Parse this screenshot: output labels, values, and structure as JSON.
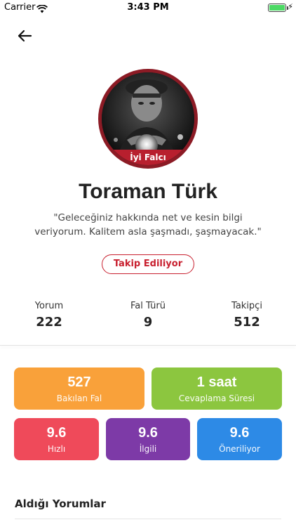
{
  "status_bar": {
    "carrier": "Carrier",
    "time": "3:43 PM",
    "battery_level": 1.0,
    "battery_color": "#4cd964"
  },
  "header": {
    "back_icon": "arrow-left-icon"
  },
  "profile": {
    "badge": "İyi Falcı",
    "name": "Toraman Türk",
    "bio": "\"Geleceğiniz hakkında net ve kesin bilgi veriyorum. Kalitem asla şaşmadı, şaşmayacak.\"",
    "follow_label": "Takip Ediliyor",
    "accent_color": "#c8202f"
  },
  "stats": [
    {
      "label": "Yorum",
      "value": "222"
    },
    {
      "label": "Fal Türü",
      "value": "9"
    },
    {
      "label": "Takipçi",
      "value": "512"
    }
  ],
  "tiles": [
    {
      "value": "527",
      "caption": "Bakılan Fal",
      "color": "#f9a13a"
    },
    {
      "value": "1 saat",
      "caption": "Cevaplama Süresi",
      "color": "#8cc63f"
    },
    {
      "value": "9.6",
      "caption": "Hızlı",
      "color": "#ef4a5a"
    },
    {
      "value": "9.6",
      "caption": "İlgili",
      "color": "#7d3aa7"
    },
    {
      "value": "9.6",
      "caption": "Öneriliyor",
      "color": "#2d8ae6"
    }
  ],
  "reviews_section": {
    "title": "Aldığı Yorumlar"
  }
}
